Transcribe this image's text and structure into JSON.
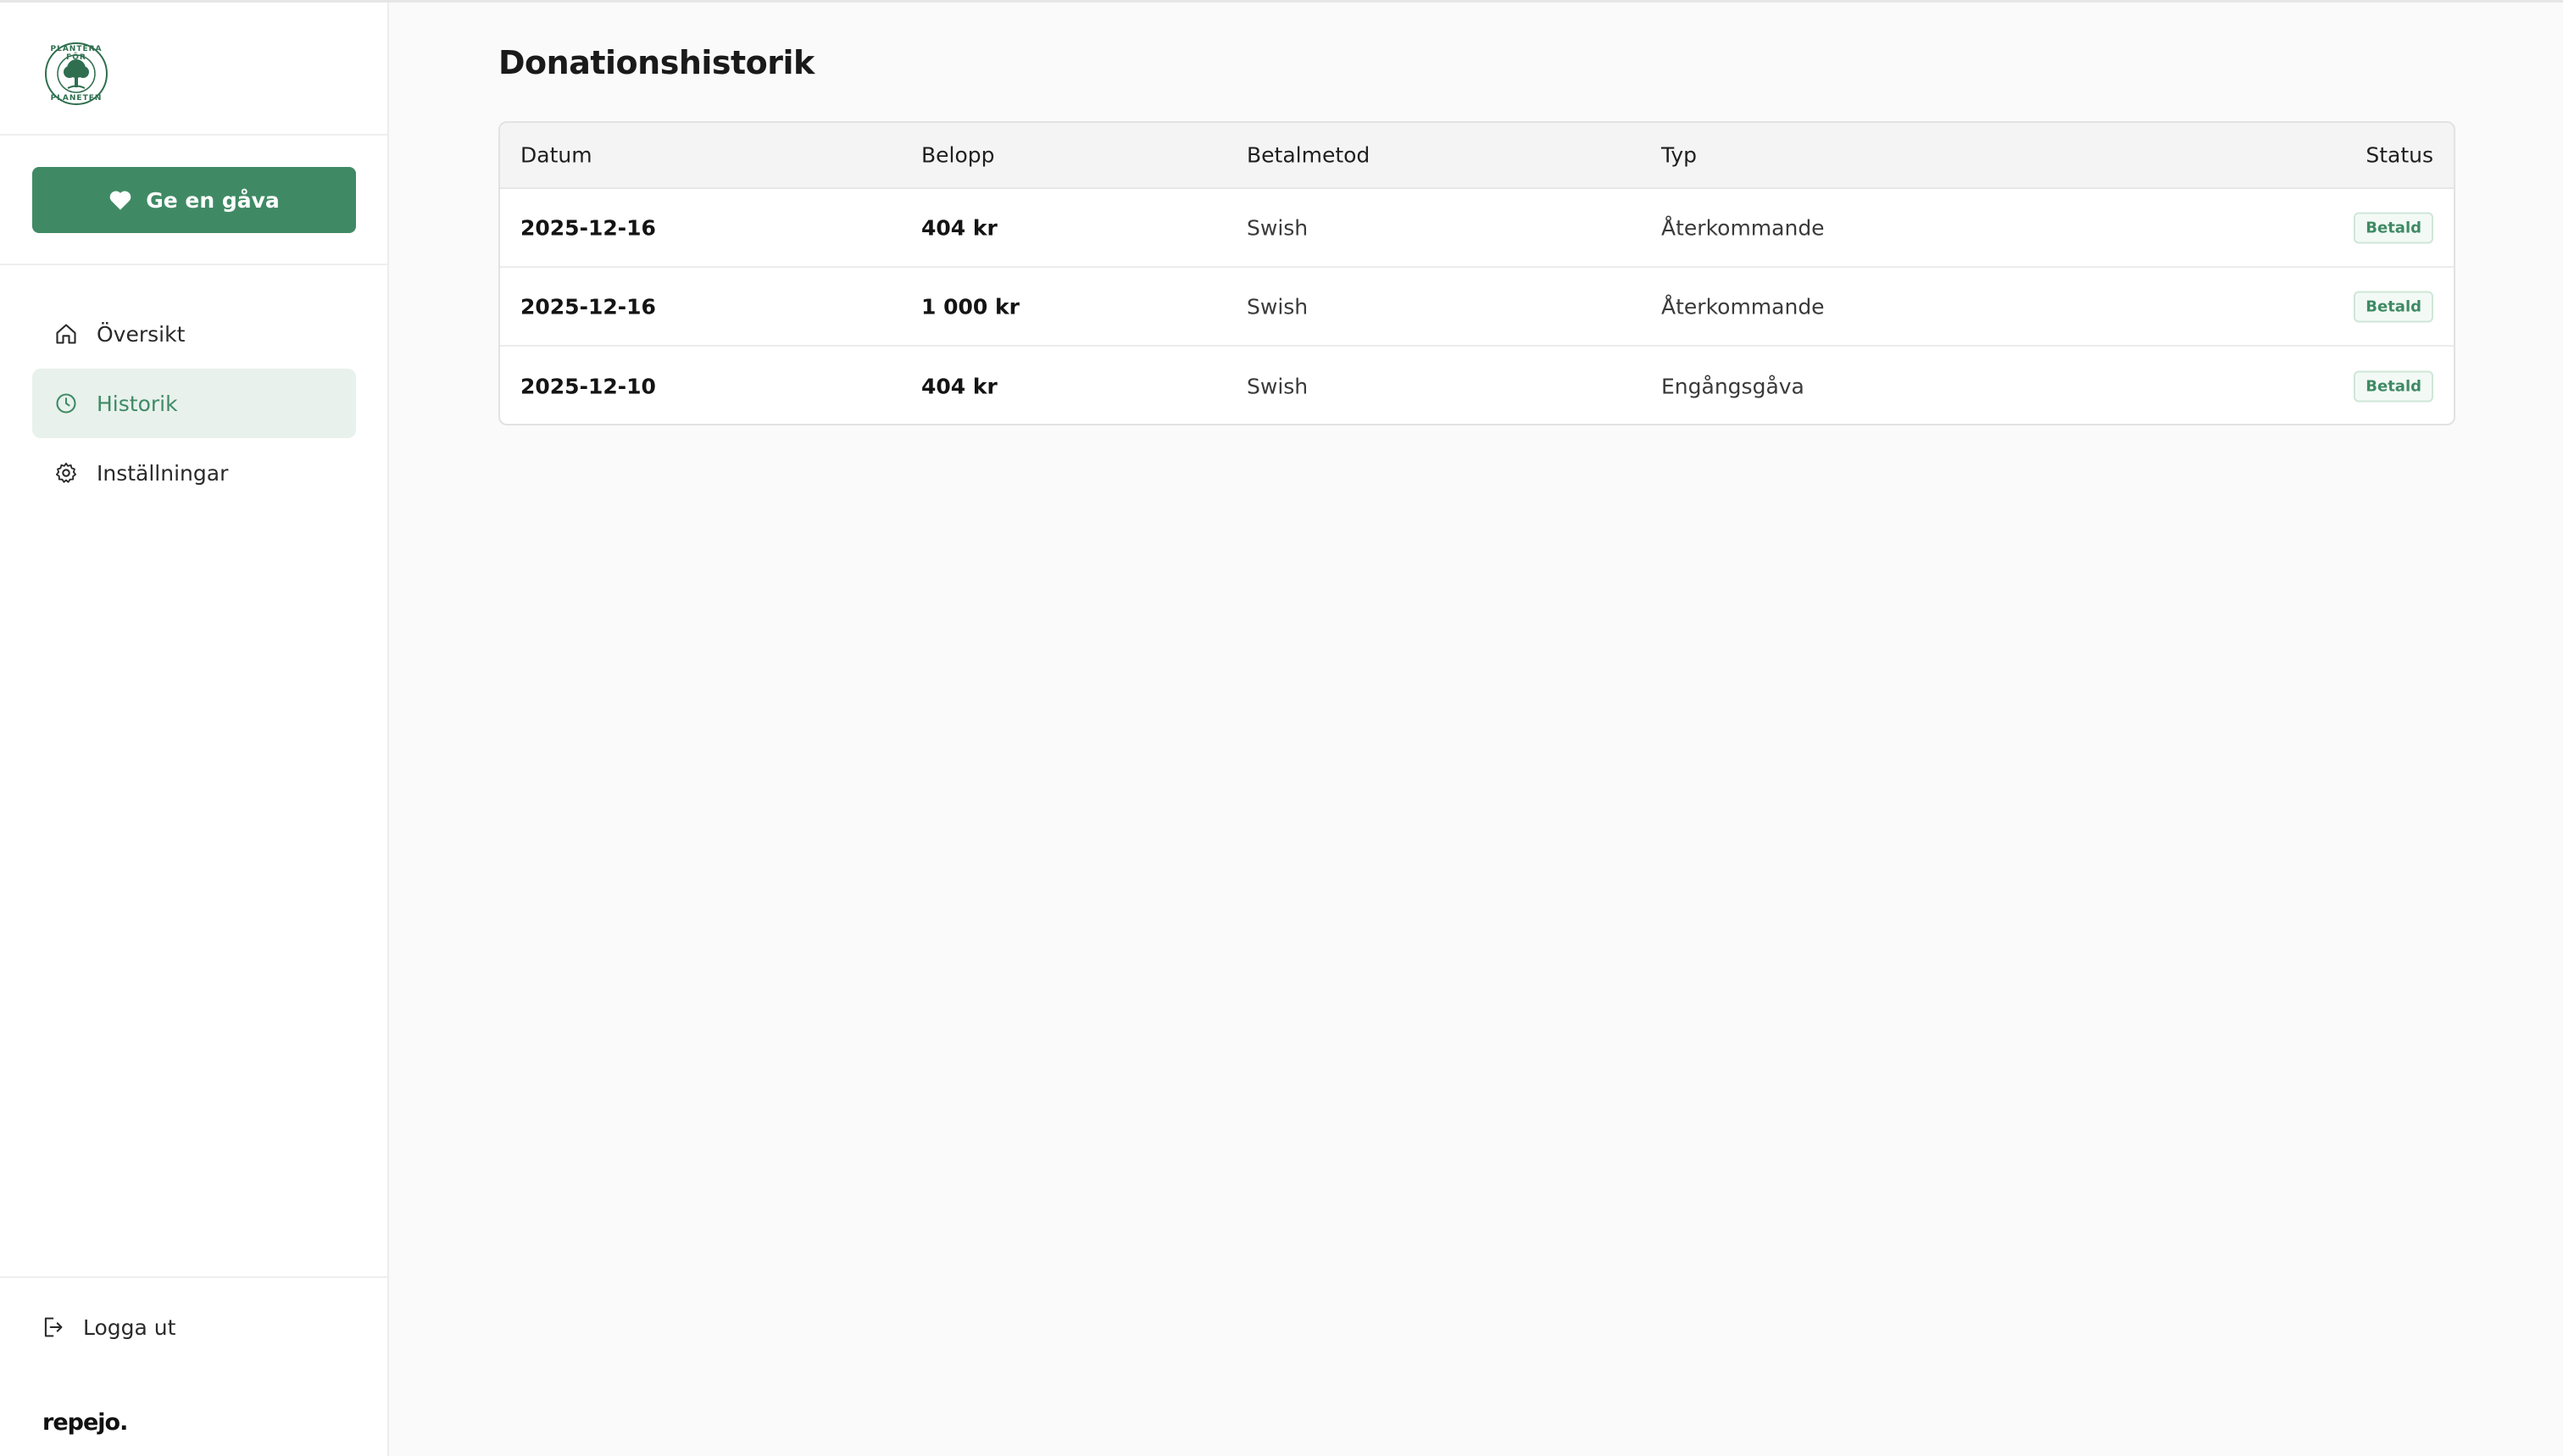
{
  "sidebar": {
    "logo_text": [
      "PLANTERA FÖR",
      "PLANETEN"
    ],
    "give_button": "Ge en gåva",
    "nav": [
      {
        "label": "Översikt",
        "icon": "home-icon"
      },
      {
        "label": "Historik",
        "icon": "clock-icon",
        "active": true
      },
      {
        "label": "Inställningar",
        "icon": "gear-icon"
      }
    ],
    "logout": "Logga ut",
    "brand": "repejo."
  },
  "main": {
    "title": "Donationshistorik",
    "table": {
      "headers": [
        "Datum",
        "Belopp",
        "Betalmetod",
        "Typ",
        "Status"
      ],
      "rows": [
        {
          "date": "2025-12-16",
          "amount": "404 kr",
          "method": "Swish",
          "type": "Återkommande",
          "status": "Betald"
        },
        {
          "date": "2025-12-16",
          "amount": "1 000 kr",
          "method": "Swish",
          "type": "Återkommande",
          "status": "Betald"
        },
        {
          "date": "2025-12-10",
          "amount": "404 kr",
          "method": "Swish",
          "type": "Engångsgåva",
          "status": "Betald"
        }
      ]
    }
  },
  "colors": {
    "accent": "#3f8a64",
    "active_bg": "#e8f1ec",
    "badge_bg": "#f3faf6"
  }
}
